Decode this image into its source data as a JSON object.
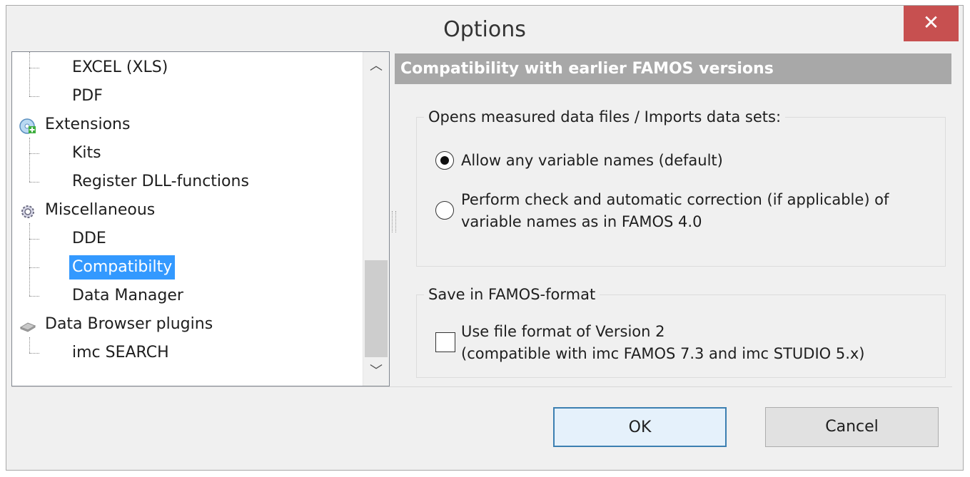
{
  "window": {
    "title": "Options",
    "close_glyph": "✕"
  },
  "tree": {
    "items": [
      {
        "label": "EXCEL (XLS)",
        "level": 1
      },
      {
        "label": "PDF",
        "level": 1
      },
      {
        "label": "Extensions",
        "level": 0,
        "icon": "extensions-icon"
      },
      {
        "label": "Kits",
        "level": 1
      },
      {
        "label": "Register DLL-functions",
        "level": 1
      },
      {
        "label": "Miscellaneous",
        "level": 0,
        "icon": "gear-icon"
      },
      {
        "label": "DDE",
        "level": 1
      },
      {
        "label": "Compatibilty",
        "level": 1,
        "selected": true
      },
      {
        "label": "Data Manager",
        "level": 1
      },
      {
        "label": "Data Browser plugins",
        "level": 0,
        "icon": "plugin-icon"
      },
      {
        "label": "imc SEARCH",
        "level": 1
      }
    ],
    "scroll_up_glyph": "︿",
    "scroll_down_glyph": "﹀"
  },
  "panel": {
    "header": "Compatibility with earlier FAMOS versions",
    "group1": {
      "legend": "Opens measured data files / Imports data sets:",
      "options": [
        {
          "line1": "Allow any variable names (default)",
          "line2": "",
          "checked": true
        },
        {
          "line1": "Perform check and automatic correction (if applicable) of",
          "line2": "variable names as in FAMOS 4.0",
          "checked": false
        }
      ]
    },
    "group2": {
      "legend": "Save in FAMOS-format",
      "checkbox": {
        "line1": "Use file format of Version 2",
        "line2": "(compatible with imc FAMOS 7.3 and imc STUDIO 5.x)",
        "checked": false
      }
    }
  },
  "buttons": {
    "ok": "OK",
    "cancel": "Cancel"
  },
  "colors": {
    "selection": "#3399ff",
    "header_bg": "#a8a8a8",
    "close_bg": "#c75050"
  }
}
